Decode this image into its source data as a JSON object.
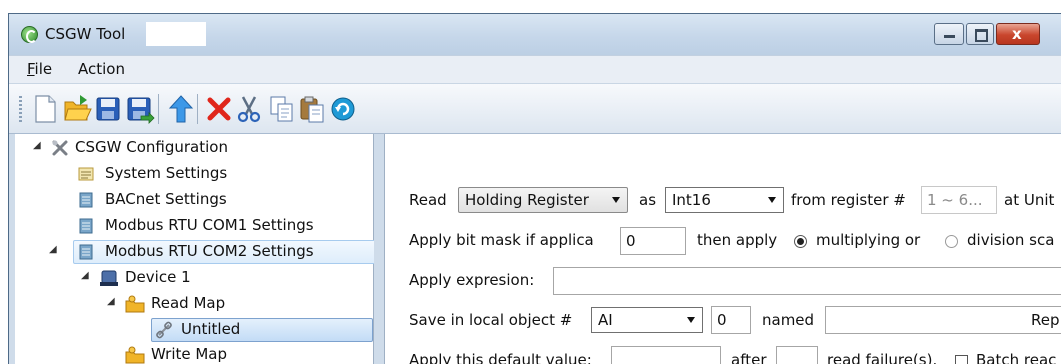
{
  "window": {
    "title": "CSGW Tool",
    "controls": [
      "minimize-icon",
      "maximize-icon",
      "close-icon"
    ],
    "close_glyph": "x"
  },
  "menu": {
    "items": [
      {
        "label": "File",
        "accel": "F",
        "rest": "ile"
      },
      {
        "label": "Action"
      }
    ]
  },
  "toolbar": {
    "icons": [
      "new-file-icon",
      "open-folder-icon",
      "save-icon",
      "save-as-icon",
      "move-up-icon",
      "delete-icon",
      "cut-icon",
      "copy-icon",
      "paste-icon",
      "refresh-icon"
    ]
  },
  "tree": {
    "root": "CSGW Configuration",
    "items": [
      "System Settings",
      "BACnet Settings",
      "Modbus RTU COM1 Settings",
      "Modbus RTU COM2 Settings",
      "Device 1",
      "Read Map",
      "Untitled",
      "Write Map"
    ]
  },
  "form": {
    "read_label": "Read",
    "register_type": "Holding Register",
    "as_label": "as",
    "data_type": "Int16",
    "from_register_label": "from register #",
    "register_placeholder": "1 ~ 6...",
    "at_unit_label": "at Unit",
    "bitmask_label": "Apply bit mask if applica",
    "bitmask_value": "0",
    "then_apply_label": "then apply",
    "multiplying_label": "multiplying or",
    "multiplying_selected": true,
    "division_label": "division sca",
    "division_selected": false,
    "expression_label": "Apply expresion:",
    "expression_value": "",
    "save_label": "Save in local object #",
    "object_type": "AI",
    "object_number": "0",
    "named_label": "named",
    "name_value": "",
    "rep_label": "Rep",
    "default_label": "Apply this default value:",
    "default_value": "",
    "after_label": "after",
    "failures_value": "",
    "failures_label": "read failure(s).",
    "batch_label": "Batch reac",
    "batch_checked": false
  }
}
